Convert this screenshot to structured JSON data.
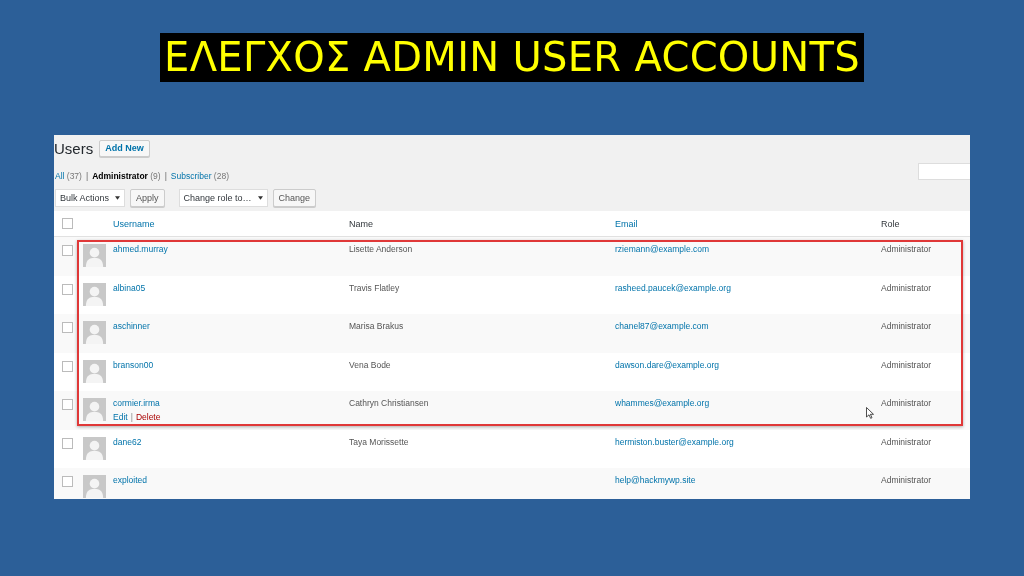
{
  "slide_title": "ΕΛΕΓΧΟΣ ADMIN USER ACCOUNTS",
  "page": {
    "heading": "Users",
    "add_button": "Add New",
    "filter_separator": "|",
    "action_separator": "|",
    "filters": [
      {
        "label": "All",
        "count": "(37)",
        "selected": false
      },
      {
        "label": "Administrator",
        "count": "(9)",
        "selected": true
      },
      {
        "label": "Subscriber",
        "count": "(28)",
        "selected": false
      }
    ],
    "bulk_actions": {
      "value": "Bulk Actions",
      "button": "Apply"
    },
    "change_role": {
      "value": "Change role to…",
      "button": "Change"
    },
    "table": {
      "select_all": {
        "checked": false
      },
      "columns": [
        "Username",
        "Name",
        "Email",
        "Role"
      ],
      "rows": [
        {
          "username": "ahmed.murray",
          "name": "Lisette Anderson",
          "email": "rziemann@example.com",
          "role": "Administrator",
          "checked": false,
          "highlighted": true
        },
        {
          "username": "albina05",
          "name": "Travis Flatley",
          "email": "rasheed.paucek@example.org",
          "role": "Administrator",
          "checked": false,
          "highlighted": true
        },
        {
          "username": "aschinner",
          "name": "Marisa Brakus",
          "email": "chanel87@example.com",
          "role": "Administrator",
          "checked": false,
          "highlighted": true
        },
        {
          "username": "branson00",
          "name": "Vena Bode",
          "email": "dawson.dare@example.org",
          "role": "Administrator",
          "checked": false,
          "highlighted": true
        },
        {
          "username": "cormier.irma",
          "name": "Cathryn Christiansen",
          "email": "whammes@example.org",
          "role": "Administrator",
          "checked": false,
          "highlighted": true,
          "actions": [
            {
              "label": "Edit",
              "kind": "edit"
            },
            {
              "label": "Delete",
              "kind": "delete"
            }
          ]
        },
        {
          "username": "dane62",
          "name": "Taya Morissette",
          "email": "hermiston.buster@example.org",
          "role": "Administrator",
          "checked": false,
          "highlighted": false
        },
        {
          "username": "exploited",
          "email": "help@hackmywp.site",
          "role": "Administrator",
          "checked": false,
          "highlighted": false
        }
      ]
    }
  }
}
